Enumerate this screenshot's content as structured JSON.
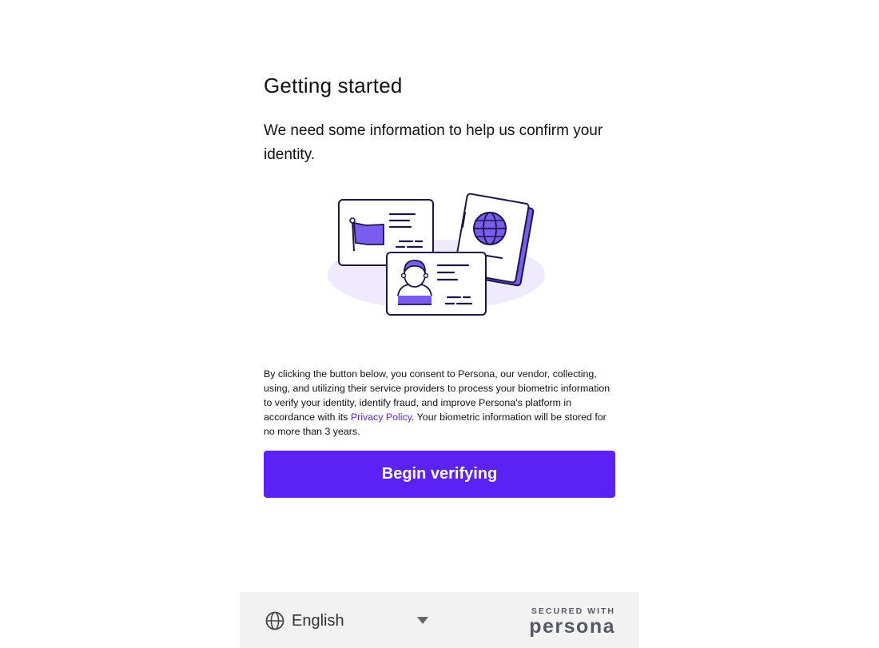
{
  "header": {
    "title": "Getting started",
    "subtitle": "We need some information to help us confirm your identity."
  },
  "illustration": {
    "name": "id-documents-illustration",
    "accent_color": "#7b5cf0",
    "outline_color": "#1e1547",
    "blob_color": "#efeafd"
  },
  "consent": {
    "text_before": "By clicking the button below, you consent to Persona, our vendor, collecting, using, and utilizing their service providers to process your biometric information to verify your identity, identify fraud, and improve Persona's platform in accordance with its ",
    "link_text": "Privacy Policy",
    "text_after": ". Your biometric information will be stored for no more than 3 years."
  },
  "primary_button": {
    "label": "Begin verifying",
    "color": "#5c22f5"
  },
  "footer": {
    "language": {
      "icon": "globe-icon",
      "selected": "English"
    },
    "secured_label": "SECURED WITH",
    "brand": "persona"
  }
}
